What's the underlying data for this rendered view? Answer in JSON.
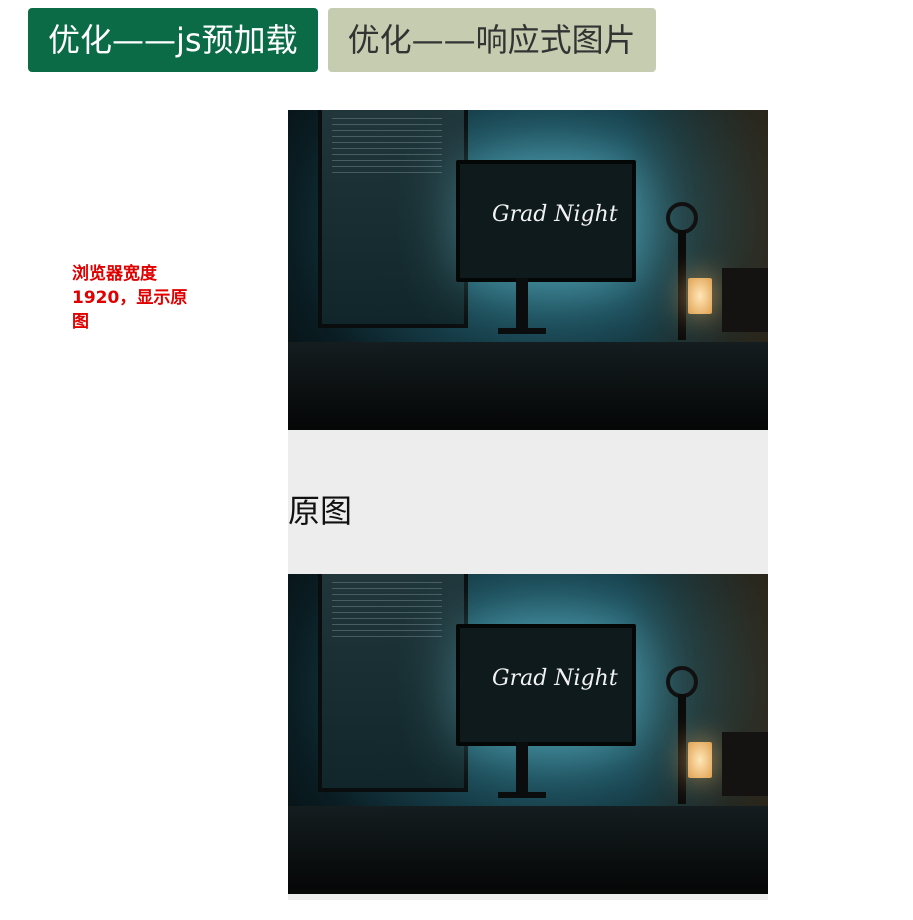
{
  "tabs": {
    "active_label": "优化——js预加载",
    "inactive_label": "优化——响应式图片"
  },
  "side_note": "浏览器宽度1920，显示原图",
  "images": [
    {
      "screen_text": "Grad Night",
      "alt": "desk setup photo"
    },
    {
      "screen_text": "Grad Night",
      "alt": "desk setup photo"
    }
  ],
  "caption": "原图",
  "colors": {
    "active_tab": "#0b6b47",
    "inactive_tab": "#c5ccb0",
    "note_text": "#e00000",
    "caption_band": "#ededed"
  }
}
